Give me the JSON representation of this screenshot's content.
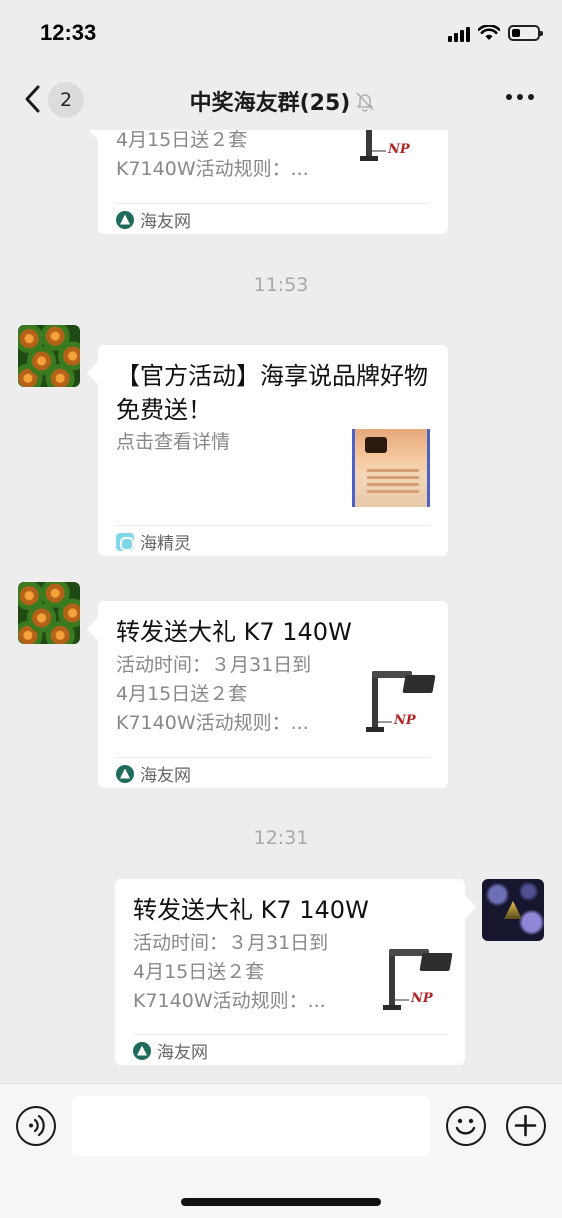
{
  "status_bar": {
    "time": "12:33",
    "battery_level": 0.35
  },
  "header": {
    "unread_count": "2",
    "title": "中奖海友群(25)",
    "icons": [
      "chevron-left-icon",
      "bell-mute-icon",
      "more-icon"
    ]
  },
  "chat": {
    "timestamps": [
      "11:53",
      "12:31"
    ],
    "messages": [
      {
        "sender": "other",
        "desc": "4月15日送２套\nK7140W活动规则：...",
        "source": "海友网"
      },
      {
        "sender": "other",
        "title": "【官方活动】海享说品牌好物免费送！",
        "desc": "点击查看详情",
        "source": "海精灵"
      },
      {
        "sender": "other",
        "title": "转发送大礼 K7 140W",
        "desc": "活动时间：３月31日到\n4月15日送２套\nK7140W活动规则：...",
        "source": "海友网"
      },
      {
        "sender": "me",
        "title": "转发送大礼 K7 140W",
        "desc": "活动时间：３月31日到\n4月15日送２套\nK7140W活动规则：...",
        "source": "海友网"
      }
    ],
    "thumb_logo": "NP"
  },
  "input_bar": {
    "input_value": "",
    "icons": [
      "voice-icon",
      "emoji-icon",
      "plus-icon"
    ]
  }
}
